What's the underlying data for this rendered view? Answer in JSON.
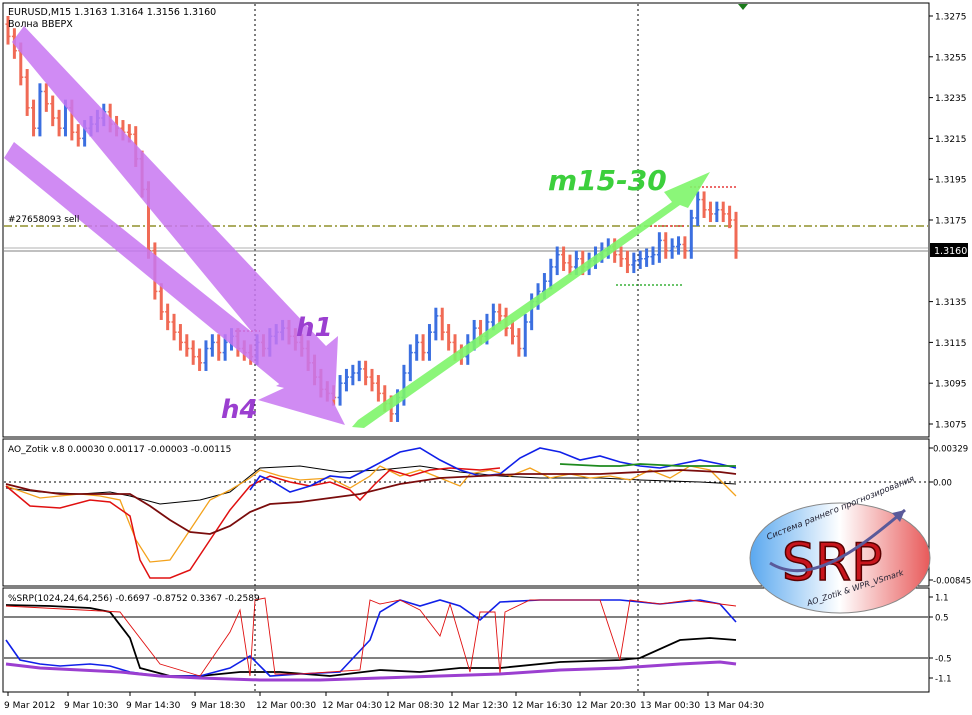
{
  "header": {
    "symbol_line": "EURUSD,M15  1.3163 1.3164 1.3156 1.3160",
    "indicator_name": "Волна ВВЕРХ"
  },
  "main_panel": {
    "order_label": "#27658093 sell",
    "current_price": "1.3160",
    "annotations": {
      "h1": "h1",
      "h4": "h4",
      "m15": "m15-30"
    },
    "price_ticks": [
      "1.3275",
      "1.3255",
      "1.3235",
      "1.3215",
      "1.3195",
      "1.3175",
      "1.3135",
      "1.3115",
      "1.3095",
      "1.3075"
    ]
  },
  "ao_panel": {
    "title": "AO_Zotik v.8 0.00030 0.00117 -0.00003 -0.00115",
    "ticks": [
      "0.00329",
      "0.00",
      "-0.00845"
    ]
  },
  "srp_panel": {
    "title": "%SRP(1024,24,64,256) -0.6697 -0.8752 0.3367 -0.2589",
    "ticks": [
      "1.1",
      "0.5",
      "-0.5",
      "-1.1"
    ]
  },
  "logo": {
    "main": "SRP",
    "arc_top": "Система раннего прогнозирования",
    "arc_bottom": "AO_Zotik & WPR_VSmark"
  },
  "time_axis": [
    "9 Mar 2012",
    "9 Mar 10:30",
    "9 Mar 14:30",
    "9 Mar 18:30",
    "12 Mar 00:30",
    "12 Mar 04:30",
    "12 Mar 08:30",
    "12 Mar 12:30",
    "12 Mar 16:30",
    "12 Mar 20:30",
    "13 Mar 00:30",
    "13 Mar 04:30"
  ],
  "colors": {
    "bull_bar": "#3b6fe0",
    "bear_bar": "#f06a55",
    "arrow_purple": "#c877f2",
    "arrow_green": "#7ef56a",
    "ao_orange": "#f3a21c",
    "ao_blue": "#1020e8",
    "ao_green": "#1e8a1e",
    "ao_red": "#e01010",
    "ao_darkred": "#7a0c0c",
    "purple_line": "#9b3fd0"
  },
  "chart_data": {
    "type": "candlestick",
    "symbol": "EURUSD",
    "timeframe": "M15",
    "ohlc_last": {
      "open": 1.3163,
      "high": 1.3164,
      "low": 1.3156,
      "close": 1.316
    },
    "order_price": 1.3172,
    "ylim": [
      1.3065,
      1.3285
    ],
    "close_series": [
      1.3265,
      1.3258,
      1.3245,
      1.323,
      1.322,
      1.3238,
      1.3232,
      1.3225,
      1.322,
      1.323,
      1.3218,
      1.3215,
      1.322,
      1.3222,
      1.3225,
      1.3228,
      1.3222,
      1.322,
      1.3218,
      1.3217,
      1.3205,
      1.319,
      1.316,
      1.314,
      1.313,
      1.3125,
      1.312,
      1.3115,
      1.3112,
      1.3108,
      1.3105,
      1.3112,
      1.3115,
      1.311,
      1.3115,
      1.3118,
      1.3112,
      1.311,
      1.3108,
      1.3115,
      1.3112,
      1.3118,
      1.312,
      1.3122,
      1.3118,
      1.3115,
      1.3112,
      1.3105,
      1.3098,
      1.3092,
      1.309,
      1.3088,
      1.3095,
      1.3098,
      1.31,
      1.3102,
      1.3098,
      1.3095,
      1.309,
      1.3085,
      1.308,
      1.3088,
      1.31,
      1.311,
      1.3115,
      1.311,
      1.312,
      1.3128,
      1.312,
      1.3115,
      1.311,
      1.3108,
      1.3115,
      1.3122,
      1.3118,
      1.3125,
      1.313,
      1.3128,
      1.3122,
      1.3118,
      1.3112,
      1.3125,
      1.3135,
      1.314,
      1.3145,
      1.3152,
      1.3158,
      1.3154,
      1.3152,
      1.3156,
      1.3152,
      1.3155,
      1.3158,
      1.316,
      1.3162,
      1.3158,
      1.3156,
      1.3153,
      1.3155,
      1.3156,
      1.3157,
      1.3158,
      1.3165,
      1.316,
      1.3162,
      1.3163,
      1.316,
      1.3176,
      1.3185,
      1.318,
      1.3178,
      1.318,
      1.3178,
      1.3175,
      1.316
    ],
    "ao_panel": {
      "ylim": [
        -0.00845,
        0.00329
      ],
      "zero": 0.0
    },
    "srp_panel": {
      "ylim": [
        -1.1,
        1.1
      ],
      "levels": [
        0.5,
        -0.5
      ]
    }
  }
}
